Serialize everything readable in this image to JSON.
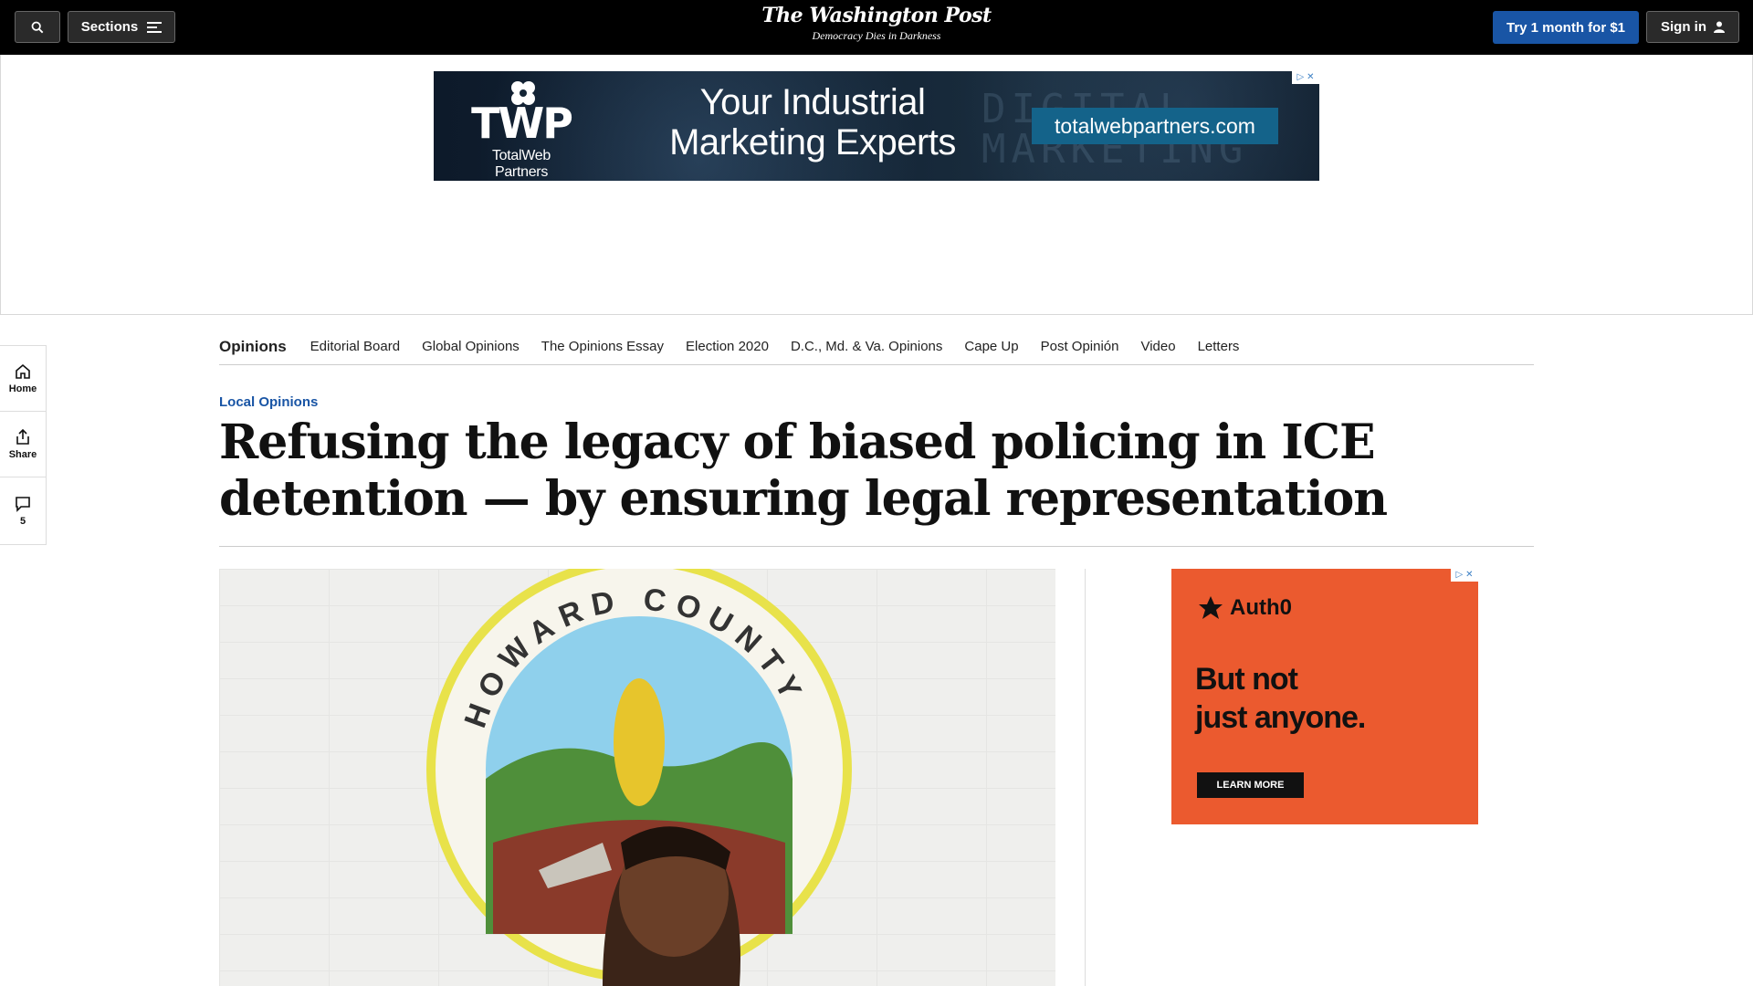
{
  "header": {
    "search_label": "",
    "sections_label": "Sections",
    "logo_name": "The Washington Post",
    "logo_tagline": "Democracy Dies in Darkness",
    "try_label": "Try 1 month for $1",
    "signin_label": "Sign in"
  },
  "banner_ad": {
    "brand_mark": "TWP",
    "brand_name": "TotalWeb Partners",
    "headline_line1": "Your Industrial",
    "headline_line2": "Marketing Experts",
    "url": "totalwebpartners.com",
    "ghost_text_1": "DIGITAL",
    "ghost_text_2": "MARKETING"
  },
  "opinions_nav": {
    "items": [
      "Opinions",
      "Editorial Board",
      "Global Opinions",
      "The Opinions Essay",
      "Election 2020",
      "D.C., Md. & Va. Opinions",
      "Cape Up",
      "Post Opinión",
      "Video",
      "Letters"
    ]
  },
  "side_rail": {
    "home_label": "Home",
    "share_label": "Share",
    "comments_count": "5"
  },
  "article": {
    "kicker": "Local Opinions",
    "headline": "Refusing the legacy of biased policing in ICE detention — by ensuring legal representation"
  },
  "photo": {
    "seal_text_top": "HOWARD COUNTY"
  },
  "side_ad": {
    "brand": "Auth0",
    "copy_line1": "But not",
    "copy_line2": "just anyone.",
    "cta": "LEARN MORE"
  },
  "colors": {
    "accent": "#1955a5",
    "topbar": "#000000",
    "ad_orange": "#eb5a2f"
  }
}
